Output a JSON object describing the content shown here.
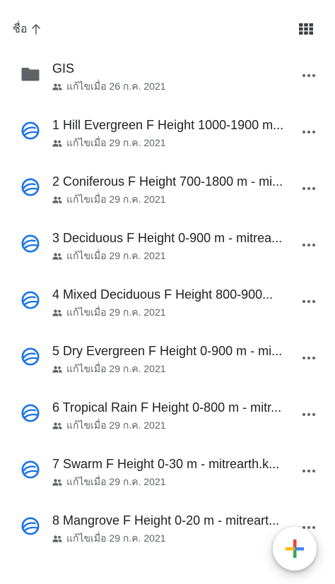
{
  "header": {
    "sort_label": "ชื่อ",
    "sort_direction": "ascending",
    "view_toggle_icon": "grid-view-icon"
  },
  "files": [
    {
      "name": "GIS",
      "type": "folder",
      "shared": true,
      "modified": "แก้ไขเมื่อ 26 ก.ค. 2021"
    },
    {
      "name": "1 Hill Evergreen F Height 1000-1900 m...",
      "type": "google-earth",
      "shared": true,
      "modified": "แก้ไขเมื่อ 29 ก.ค. 2021"
    },
    {
      "name": "2  Coniferous F Height 700-1800 m - mi...",
      "type": "google-earth",
      "shared": true,
      "modified": "แก้ไขเมื่อ 29 ก.ค. 2021"
    },
    {
      "name": "3 Deciduous F Height 0-900 m - mitrea...",
      "type": "google-earth",
      "shared": true,
      "modified": "แก้ไขเมื่อ 29 ก.ค. 2021"
    },
    {
      "name": "4 Mixed Deciduous F Height 800-900...",
      "type": "google-earth",
      "shared": true,
      "modified": "แก้ไขเมื่อ 29 ก.ค. 2021"
    },
    {
      "name": "5 Dry Evergreen F Height 0-900 m - mi...",
      "type": "google-earth",
      "shared": true,
      "modified": "แก้ไขเมื่อ 29 ก.ค. 2021"
    },
    {
      "name": "6 Tropical Rain F Height 0-800 m - mitr...",
      "type": "google-earth",
      "shared": true,
      "modified": "แก้ไขเมื่อ 29 ก.ค. 2021"
    },
    {
      "name": "7 Swarm F Height 0-30 m - mitrearth.k...",
      "type": "google-earth",
      "shared": true,
      "modified": "แก้ไขเมื่อ 29 ก.ค. 2021"
    },
    {
      "name": "8 Mangrove F Height 0-20 m - mitreart...",
      "type": "google-earth",
      "shared": true,
      "modified": "แก้ไขเมื่อ 29 ก.ค. 2021"
    }
  ],
  "fab": {
    "icon": "plus-icon"
  },
  "colors": {
    "text_primary": "#202124",
    "text_secondary": "#5f6368",
    "folder": "#5f6368",
    "earth_blue": "#1a73e8",
    "google_blue": "#4285f4",
    "google_red": "#ea4335",
    "google_yellow": "#fbbc04",
    "google_green": "#34a853"
  }
}
